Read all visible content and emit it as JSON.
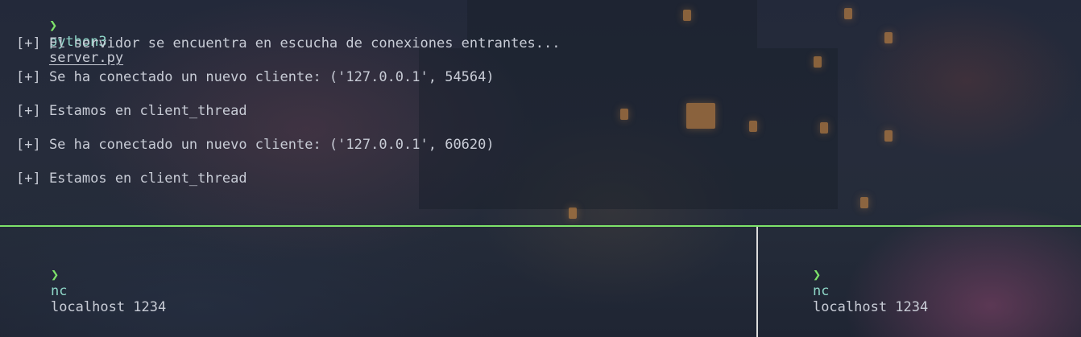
{
  "top_pane": {
    "prompt": {
      "arrow": "❯",
      "command": "python3",
      "argument": "server.py"
    },
    "output": [
      "[+] El servidor se encuentra en escucha de conexiones entrantes...",
      "[+] Se ha conectado un nuevo cliente: ('127.0.0.1', 54564)",
      "[+] Estamos en client_thread",
      "[+] Se ha conectado un nuevo cliente: ('127.0.0.1', 60620)",
      "[+] Estamos en client_thread"
    ]
  },
  "bottom_left_pane": {
    "prompt": {
      "arrow": "❯",
      "command": "nc",
      "argument": "localhost 1234"
    }
  },
  "bottom_right_pane": {
    "prompt": {
      "arrow": "❯",
      "command": "nc",
      "argument": "localhost 1234"
    }
  },
  "colors": {
    "active_split": "#7ee36a",
    "inactive_split": "#dcdcdc",
    "prompt_arrow": "#7ee36a",
    "command": "#8fd7c8",
    "text": "#c8ccd6",
    "background": "#1f2530"
  }
}
